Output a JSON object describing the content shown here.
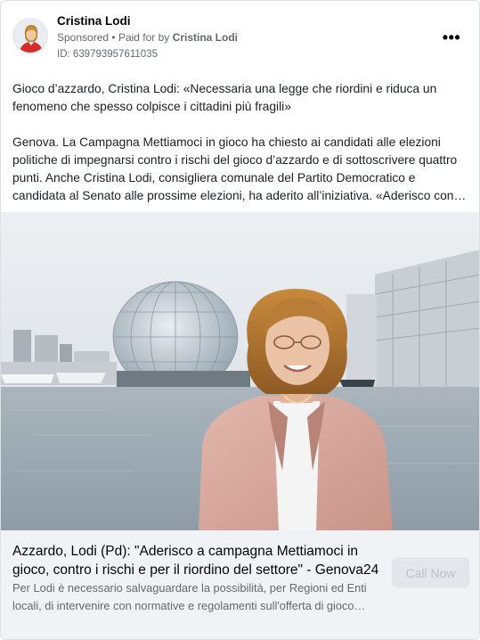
{
  "advertiser": {
    "name": "Cristina Lodi",
    "sponsored_label": "Sponsored",
    "separator": "•",
    "paid_for_prefix": "Paid for by",
    "paid_for_by": "Cristina Lodi",
    "ad_id": "ID: 639793957611035"
  },
  "menu": {
    "icon": "more-horizontal-icon",
    "label": "•••"
  },
  "post": {
    "headline": "Gioco d’azzardo, Cristina Lodi: «Necessaria una legge che riordini e riduca un fenomeno che spesso colpisce i cittadini più fragili»",
    "body": "Genova. La Campagna Mettiamoci in gioco ha chiesto ai candidati alle elezioni politiche di impegnarsi contro i rischi del gioco d’azzardo e di sottoscrivere quattro punti. Anche Cristina Lodi, consigliera comunale del Partito Democratico e candidata al Senato alle prossime elezioni, ha aderito all’iniziativa. «Aderisco con convinzione alla campagna»"
  },
  "link": {
    "title": "Azzardo, Lodi (Pd): \"Aderisco a campagna Mettiamoci in gioco, contro i rischi e per il riordino del settore\" - Genova24",
    "description": "Per Lodi è necessario salvaguardare la possibilità, per Regioni ed Enti locali, di intervenire con normative e regolamenti sull'offerta di gioco d'azzardo",
    "cta_label": "Call Now"
  },
  "colors": {
    "secondary_text": "#65676b",
    "footer_bg": "#f0f2f5",
    "cta_bg": "#e4e6eb",
    "cta_text": "#bcc0c4"
  }
}
